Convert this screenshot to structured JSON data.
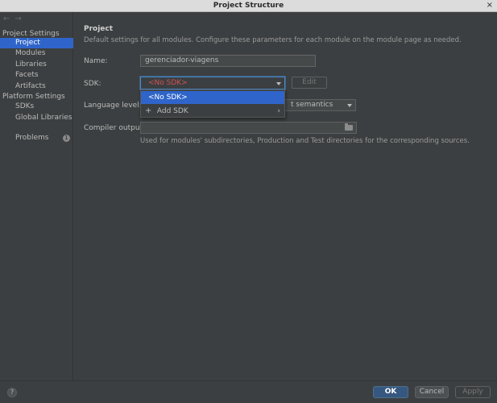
{
  "window": {
    "title": "Project Structure",
    "close_glyph": "×"
  },
  "sidebar": {
    "back_glyph": "←",
    "forward_glyph": "→",
    "project_settings_header": "Project Settings",
    "project_settings_items": [
      "Project",
      "Modules",
      "Libraries",
      "Facets",
      "Artifacts"
    ],
    "platform_settings_header": "Platform Settings",
    "platform_settings_items": [
      "SDKs",
      "Global Libraries"
    ],
    "problems_label": "Problems",
    "problems_count": "1",
    "selected_item": "Project"
  },
  "main": {
    "section_title": "Project",
    "description": "Default settings for all modules. Configure these parameters for each module on the module page as needed.",
    "name_label": "Name:",
    "name_value": "gerenciador-viagens",
    "sdk_label": "SDK:",
    "sdk_value": "<No SDK>",
    "edit_label": "Edit",
    "language_level_label": "Language level:",
    "language_level_value": "t semantics",
    "compiler_output_label": "Compiler output:",
    "compiler_output_value": "",
    "compiler_output_hint": "Used for modules' subdirectories, Production and Test directories for the corresponding sources."
  },
  "sdk_dropdown": {
    "options": [
      "<No SDK>",
      "Add SDK"
    ],
    "selected": "<No SDK>"
  },
  "footer": {
    "help_glyph": "?",
    "ok_label": "OK",
    "cancel_label": "Cancel",
    "apply_label": "Apply"
  },
  "colors": {
    "selection": "#2f65ca",
    "error_text": "#d25252",
    "ok_button": "#365880"
  }
}
